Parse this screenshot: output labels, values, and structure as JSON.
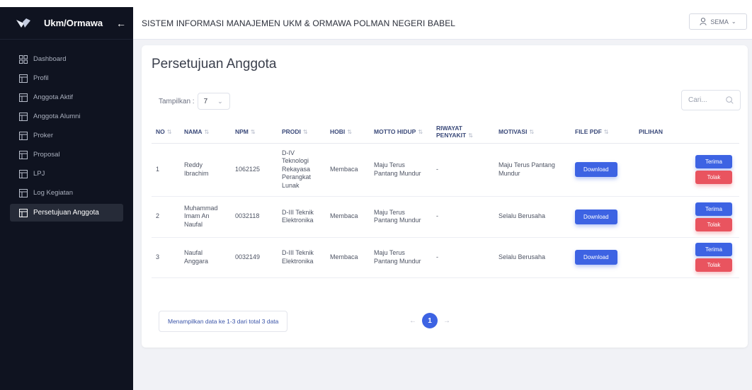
{
  "sidebar": {
    "brand": "Ukm/Ormawa",
    "back_icon": "arrow-left-icon",
    "items": [
      {
        "label": "Dashboard",
        "icon": "grid-icon"
      },
      {
        "label": "Profil",
        "icon": "table-icon"
      },
      {
        "label": "Anggota Aktif",
        "icon": "table-icon"
      },
      {
        "label": "Anggota Alumni",
        "icon": "table-icon"
      },
      {
        "label": "Proker",
        "icon": "table-icon"
      },
      {
        "label": "Proposal",
        "icon": "table-icon"
      },
      {
        "label": "LPJ",
        "icon": "table-icon"
      },
      {
        "label": "Log Kegiatan",
        "icon": "table-icon"
      },
      {
        "label": "Persetujuan Anggota",
        "icon": "table-icon",
        "active": true
      }
    ]
  },
  "header": {
    "title": "SISTEM INFORMASI MANAJEMEN UKM & ORMAWA POLMAN NEGERI BABEL",
    "user": "SEMA"
  },
  "page": {
    "title": "Persetujuan Anggota",
    "show_label": "Tampilkan :",
    "show_value": "7",
    "search_placeholder": "Cari..."
  },
  "table": {
    "headers": [
      "NO",
      "NAMA",
      "NPM",
      "PRODI",
      "HOBI",
      "MOTTO HIDUP",
      "RIWAYAT PENYAKIT",
      "MOTIVASI",
      "FILE PDF",
      "PILIHAN"
    ],
    "rows": [
      {
        "no": "1",
        "nama": "Reddy Ibrachim",
        "npm": "1062125",
        "prodi": "D-IV Teknologi Rekayasa Perangkat Lunak",
        "hobi": "Membaca",
        "motto": "Maju Terus Pantang Mundur",
        "riwayat": "-",
        "motivasi": "Maju Terus Pantang Mundur"
      },
      {
        "no": "2",
        "nama": "Muhammad Imam An Naufal",
        "npm": "0032118",
        "prodi": "D-III Teknik Elektronika",
        "hobi": "Membaca",
        "motto": "Maju Terus Pantang Mundur",
        "riwayat": "-",
        "motivasi": "Selalu Berusaha"
      },
      {
        "no": "3",
        "nama": "Naufal Anggara",
        "npm": "0032149",
        "prodi": "D-III Teknik Elektronika",
        "hobi": "Membaca",
        "motto": "Maju Terus Pantang Mundur",
        "riwayat": "-",
        "motivasi": "Selalu Berusaha"
      }
    ],
    "download_label": "Download",
    "accept_label": "Terima",
    "reject_label": "Tolak"
  },
  "footer": {
    "info": "Menampilkan data ke 1-3 dari total 3 data",
    "current_page": "1"
  },
  "colors": {
    "sidebar_bg": "#0f1320",
    "primary": "#3d63e3",
    "danger": "#e9545f"
  }
}
